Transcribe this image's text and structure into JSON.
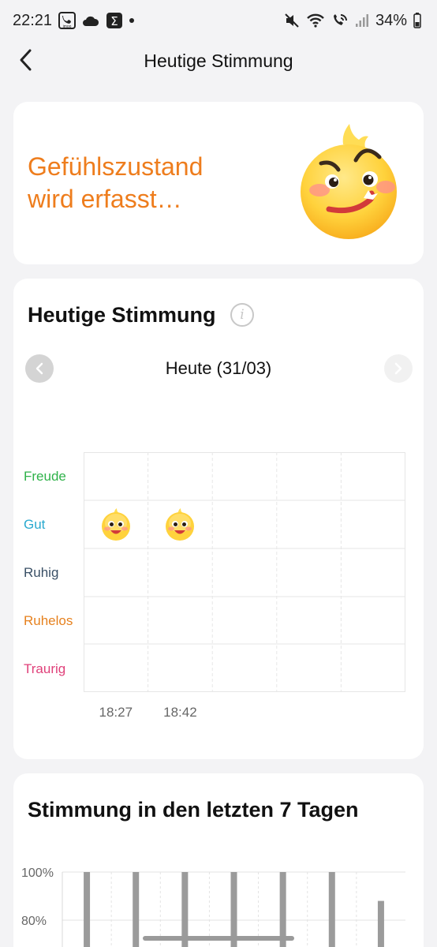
{
  "status_bar": {
    "time": "22:21",
    "imoo_label": "imoo",
    "sigma_label": "Σ",
    "battery": "34%",
    "icons": [
      "imoo-app-icon",
      "cloud-icon",
      "sigma-app-icon",
      "notification-dot-icon",
      "mute-icon",
      "wifi-icon",
      "wifi-call-icon",
      "signal-icon",
      "battery-icon"
    ]
  },
  "header": {
    "title": "Heutige Stimmung",
    "back_icon": "chevron-left-icon"
  },
  "emotion_card": {
    "status_line1": "Gefühlszustand",
    "status_line2": "wird erfasst…",
    "accent_color": "#ee7d1d"
  },
  "today_card": {
    "title": "Heutige Stimmung",
    "info_glyph": "i",
    "date_label": "Heute (31/03)",
    "moods": [
      {
        "label": "Freude",
        "color": "#2fb24a"
      },
      {
        "label": "Gut",
        "color": "#29a9cf"
      },
      {
        "label": "Ruhig",
        "color": "#3a5066"
      },
      {
        "label": "Ruhelos",
        "color": "#e6811e"
      },
      {
        "label": "Traurig",
        "color": "#e0417a"
      }
    ],
    "entries": [
      {
        "time": "18:27",
        "mood": "Gut"
      },
      {
        "time": "18:42",
        "mood": "Gut"
      }
    ]
  },
  "week_card": {
    "title": "Stimmung in den letzten 7 Tagen",
    "y_labels": [
      "100%",
      "80%"
    ],
    "bar_color": "#9b9b9b",
    "bar_levels": [
      1,
      1,
      1,
      1,
      1,
      1,
      0.88
    ]
  }
}
